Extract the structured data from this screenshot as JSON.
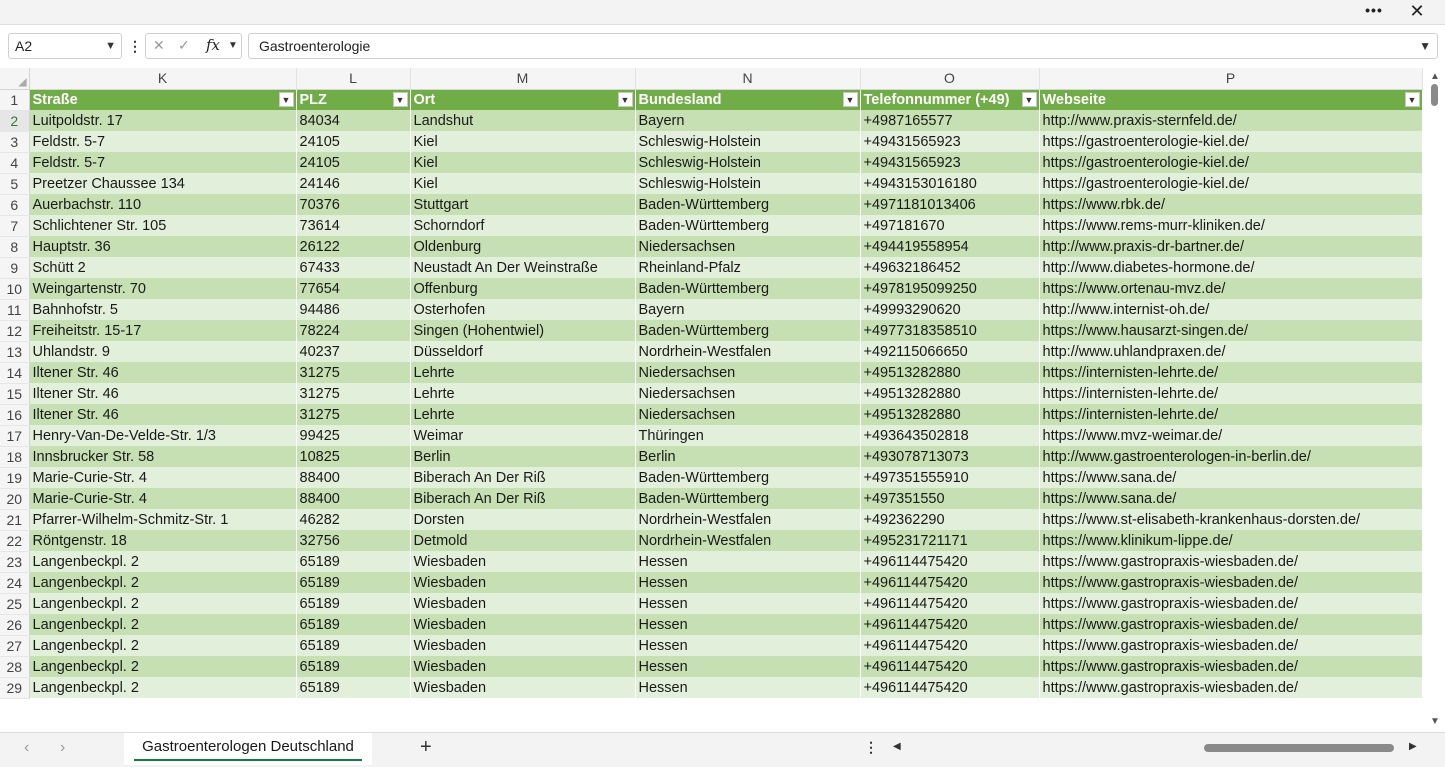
{
  "window": {
    "more_label": "•••",
    "close_label": "✕"
  },
  "formula_bar": {
    "name_box": "A2",
    "fx_label": "fx",
    "cancel_icon": "✕",
    "confirm_icon": "✓",
    "value": "Gastroenterologie"
  },
  "columns": [
    "K",
    "L",
    "M",
    "N",
    "O",
    "P"
  ],
  "header_row": {
    "number": "1",
    "labels": [
      "Straße",
      "PLZ",
      "Ort",
      "Bundesland",
      "Telefonnummer (+49)",
      "Webseite"
    ]
  },
  "rows": [
    {
      "n": "2",
      "cells": [
        "Luitpoldstr. 17",
        "84034",
        "Landshut",
        "Bayern",
        "+4987165577",
        "http://www.praxis-sternfeld.de/"
      ]
    },
    {
      "n": "3",
      "cells": [
        "Feldstr. 5-7",
        "24105",
        "Kiel",
        "Schleswig-Holstein",
        "+49431565923",
        "https://gastroenterologie-kiel.de/"
      ]
    },
    {
      "n": "4",
      "cells": [
        "Feldstr. 5-7",
        "24105",
        "Kiel",
        "Schleswig-Holstein",
        "+49431565923",
        "https://gastroenterologie-kiel.de/"
      ]
    },
    {
      "n": "5",
      "cells": [
        "Preetzer Chaussee 134",
        "24146",
        "Kiel",
        "Schleswig-Holstein",
        "+4943153016180",
        "https://gastroenterologie-kiel.de/"
      ]
    },
    {
      "n": "6",
      "cells": [
        "Auerbachstr. 110",
        "70376",
        "Stuttgart",
        "Baden-Württemberg",
        "+4971181013406",
        "https://www.rbk.de/"
      ]
    },
    {
      "n": "7",
      "cells": [
        "Schlichtener Str. 105",
        "73614",
        "Schorndorf",
        "Baden-Württemberg",
        "+497181670",
        "https://www.rems-murr-kliniken.de/"
      ]
    },
    {
      "n": "8",
      "cells": [
        "Hauptstr. 36",
        "26122",
        "Oldenburg",
        "Niedersachsen",
        "+494419558954",
        "http://www.praxis-dr-bartner.de/"
      ]
    },
    {
      "n": "9",
      "cells": [
        "Schütt 2",
        "67433",
        "Neustadt An Der Weinstraße",
        "Rheinland-Pfalz",
        "+49632186452",
        "http://www.diabetes-hormone.de/"
      ]
    },
    {
      "n": "10",
      "cells": [
        "Weingartenstr. 70",
        "77654",
        "Offenburg",
        "Baden-Württemberg",
        "+4978195099250",
        "https://www.ortenau-mvz.de/"
      ]
    },
    {
      "n": "11",
      "cells": [
        "Bahnhofstr. 5",
        "94486",
        "Osterhofen",
        "Bayern",
        "+49993290620",
        "http://www.internist-oh.de/"
      ]
    },
    {
      "n": "12",
      "cells": [
        "Freiheitstr. 15-17",
        "78224",
        "Singen (Hohentwiel)",
        "Baden-Württemberg",
        "+4977318358510",
        "https://www.hausarzt-singen.de/"
      ]
    },
    {
      "n": "13",
      "cells": [
        "Uhlandstr. 9",
        "40237",
        "Düsseldorf",
        "Nordrhein-Westfalen",
        "+492115066650",
        "http://www.uhlandpraxen.de/"
      ]
    },
    {
      "n": "14",
      "cells": [
        "Iltener Str. 46",
        "31275",
        "Lehrte",
        "Niedersachsen",
        "+49513282880",
        "https://internisten-lehrte.de/"
      ]
    },
    {
      "n": "15",
      "cells": [
        "Iltener Str. 46",
        "31275",
        "Lehrte",
        "Niedersachsen",
        "+49513282880",
        "https://internisten-lehrte.de/"
      ]
    },
    {
      "n": "16",
      "cells": [
        "Iltener Str. 46",
        "31275",
        "Lehrte",
        "Niedersachsen",
        "+49513282880",
        "https://internisten-lehrte.de/"
      ]
    },
    {
      "n": "17",
      "cells": [
        "Henry-Van-De-Velde-Str. 1/3",
        "99425",
        "Weimar",
        "Thüringen",
        "+493643502818",
        "https://www.mvz-weimar.de/"
      ]
    },
    {
      "n": "18",
      "cells": [
        "Innsbrucker Str. 58",
        "10825",
        "Berlin",
        "Berlin",
        "+493078713073",
        "http://www.gastroenterologen-in-berlin.de/"
      ]
    },
    {
      "n": "19",
      "cells": [
        "Marie-Curie-Str. 4",
        "88400",
        "Biberach An Der Riß",
        "Baden-Württemberg",
        "+497351555910",
        "https://www.sana.de/"
      ]
    },
    {
      "n": "20",
      "cells": [
        "Marie-Curie-Str. 4",
        "88400",
        "Biberach An Der Riß",
        "Baden-Württemberg",
        "+497351550",
        "https://www.sana.de/"
      ]
    },
    {
      "n": "21",
      "cells": [
        "Pfarrer-Wilhelm-Schmitz-Str. 1",
        "46282",
        "Dorsten",
        "Nordrhein-Westfalen",
        "+492362290",
        "https://www.st-elisabeth-krankenhaus-dorsten.de/"
      ]
    },
    {
      "n": "22",
      "cells": [
        "Röntgenstr. 18",
        "32756",
        "Detmold",
        "Nordrhein-Westfalen",
        "+495231721171",
        "https://www.klinikum-lippe.de/"
      ]
    },
    {
      "n": "23",
      "cells": [
        "Langenbeckpl. 2",
        "65189",
        "Wiesbaden",
        "Hessen",
        "+496114475420",
        "https://www.gastropraxis-wiesbaden.de/"
      ]
    },
    {
      "n": "24",
      "cells": [
        "Langenbeckpl. 2",
        "65189",
        "Wiesbaden",
        "Hessen",
        "+496114475420",
        "https://www.gastropraxis-wiesbaden.de/"
      ]
    },
    {
      "n": "25",
      "cells": [
        "Langenbeckpl. 2",
        "65189",
        "Wiesbaden",
        "Hessen",
        "+496114475420",
        "https://www.gastropraxis-wiesbaden.de/"
      ]
    },
    {
      "n": "26",
      "cells": [
        "Langenbeckpl. 2",
        "65189",
        "Wiesbaden",
        "Hessen",
        "+496114475420",
        "https://www.gastropraxis-wiesbaden.de/"
      ]
    },
    {
      "n": "27",
      "cells": [
        "Langenbeckpl. 2",
        "65189",
        "Wiesbaden",
        "Hessen",
        "+496114475420",
        "https://www.gastropraxis-wiesbaden.de/"
      ]
    },
    {
      "n": "28",
      "cells": [
        "Langenbeckpl. 2",
        "65189",
        "Wiesbaden",
        "Hessen",
        "+496114475420",
        "https://www.gastropraxis-wiesbaden.de/"
      ]
    },
    {
      "n": "29",
      "cells": [
        "Langenbeckpl. 2",
        "65189",
        "Wiesbaden",
        "Hessen",
        "+496114475420",
        "https://www.gastropraxis-wiesbaden.de/"
      ]
    }
  ],
  "sheet_tabs": {
    "active": "Gastroenterologen Deutschland",
    "add_label": "+"
  },
  "colors": {
    "header_green": "#70ad47",
    "band_dark": "#c6e0b4",
    "band_light": "#e2efda",
    "tab_underline": "#107c41"
  }
}
